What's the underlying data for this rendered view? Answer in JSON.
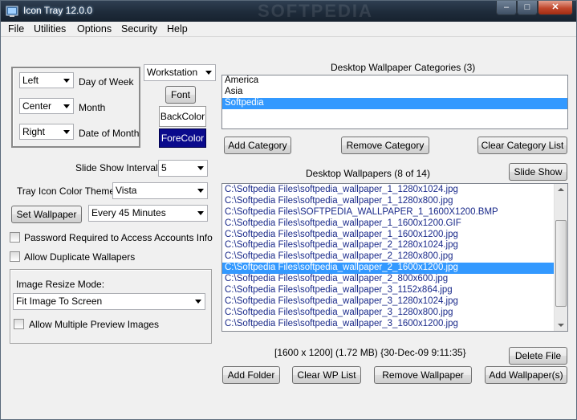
{
  "window": {
    "title": "Icon Tray 12.0.0",
    "watermark": "SOFTPEDIA"
  },
  "menu": [
    "File",
    "Utilities",
    "Options",
    "Security",
    "Help"
  ],
  "format": {
    "options": [
      {
        "value": "Left",
        "label": "Day of Week"
      },
      {
        "value": "Center",
        "label": "Month"
      },
      {
        "value": "Right",
        "label": "Date of Month"
      }
    ],
    "workstation": "Workstation",
    "font_button": "Font",
    "backcolor": "BackColor",
    "forecolor": "ForeColor"
  },
  "slideshow": {
    "label": "Slide Show Interval:",
    "value": "5"
  },
  "theme": {
    "label": "Tray Icon Color Themes:",
    "value": "Vista"
  },
  "set_wallpaper": {
    "button": "Set Wallpaper",
    "value": "Every 45 Minutes"
  },
  "checks": {
    "password": "Password Required to Access Accounts Info",
    "duplicates": "Allow Duplicate Wallapers"
  },
  "resize": {
    "label": "Image Resize Mode:",
    "value": "Fit Image To Screen",
    "preview_check": "Allow Multiple Preview Images"
  },
  "categories": {
    "title": "Desktop Wallpaper Categories (3)",
    "items": [
      "America",
      "Asia",
      "Softpedia"
    ],
    "selected": 2,
    "buttons": {
      "add": "Add Category",
      "remove": "Remove Category",
      "clear": "Clear Category List"
    }
  },
  "wallpapers": {
    "title": "Desktop Wallpapers (8 of 14)",
    "slide_show_button": "Slide Show",
    "items": [
      "C:\\Softpedia Files\\softpedia_wallpaper_1_1280x1024.jpg",
      "C:\\Softpedia Files\\softpedia_wallpaper_1_1280x800.jpg",
      "C:\\Softpedia Files\\SOFTPEDIA_WALLPAPER_1_1600X1200.BMP",
      "C:\\Softpedia Files\\softpedia_wallpaper_1_1600x1200.GIF",
      "C:\\Softpedia Files\\softpedia_wallpaper_1_1600x1200.jpg",
      "C:\\Softpedia Files\\softpedia_wallpaper_2_1280x1024.jpg",
      "C:\\Softpedia Files\\softpedia_wallpaper_2_1280x800.jpg",
      "C:\\Softpedia Files\\softpedia_wallpaper_2_1600x1200.jpg",
      "C:\\Softpedia Files\\softpedia_wallpaper_2_800x600.jpg",
      "C:\\Softpedia Files\\softpedia_wallpaper_3_1152x864.jpg",
      "C:\\Softpedia Files\\softpedia_wallpaper_3_1280x1024.jpg",
      "C:\\Softpedia Files\\softpedia_wallpaper_3_1280x800.jpg",
      "C:\\Softpedia Files\\softpedia_wallpaper_3_1600x1200.jpg"
    ],
    "selected": 7,
    "info": "[1600 x 1200] (1.72 MB) {30-Dec-09 9:11:35}",
    "buttons": {
      "delete": "Delete File",
      "add_folder": "Add Folder",
      "clear": "Clear WP List",
      "remove": "Remove Wallpaper",
      "add": "Add Wallpaper(s)"
    }
  },
  "colors": {
    "forecolor_bg": "#0a0a8c",
    "selection": "#3399ff",
    "list_text": "#1a2a8a"
  }
}
